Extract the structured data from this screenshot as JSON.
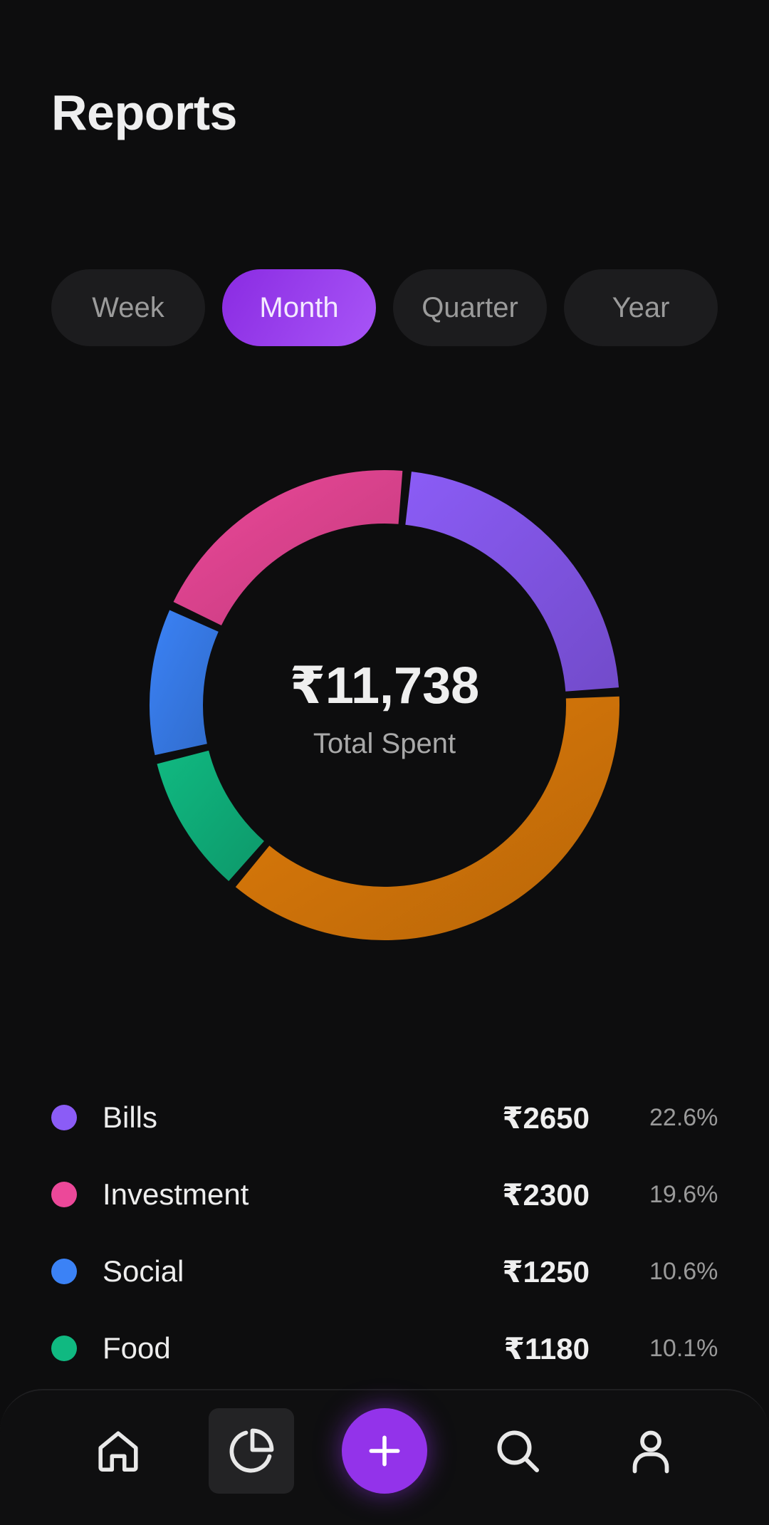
{
  "header": {
    "title": "Reports"
  },
  "tabs": [
    {
      "label": "Week",
      "active": false
    },
    {
      "label": "Month",
      "active": true
    },
    {
      "label": "Quarter",
      "active": false
    },
    {
      "label": "Year",
      "active": false
    }
  ],
  "summary": {
    "total": "₹11,738",
    "label": "Total Spent"
  },
  "chart_data": {
    "type": "pie",
    "style": "donut",
    "categories": [
      "Bills",
      "Orange segment",
      "Food",
      "Social",
      "Investment"
    ],
    "values": [
      2650,
      4358,
      1180,
      1250,
      2300
    ],
    "colors": [
      "#8b5cf6",
      "#e07c0a",
      "#10b981",
      "#3b82f6",
      "#ec4899"
    ],
    "total": 11738
  },
  "legend": [
    {
      "name": "Bills",
      "amount": "₹2650",
      "percent": "22.6%",
      "color": "#8b5cf6"
    },
    {
      "name": "Investment",
      "amount": "₹2300",
      "percent": "19.6%",
      "color": "#ec4899"
    },
    {
      "name": "Social",
      "amount": "₹1250",
      "percent": "10.6%",
      "color": "#3b82f6"
    },
    {
      "name": "Food",
      "amount": "₹1180",
      "percent": "10.1%",
      "color": "#10b981"
    }
  ],
  "nav": {
    "items": [
      {
        "icon": "home-icon",
        "active": false
      },
      {
        "icon": "pie-chart-icon",
        "active": true
      },
      {
        "icon": "plus-icon",
        "active": false
      },
      {
        "icon": "search-icon",
        "active": false
      },
      {
        "icon": "user-icon",
        "active": false
      }
    ],
    "accent": "#9333ea"
  }
}
